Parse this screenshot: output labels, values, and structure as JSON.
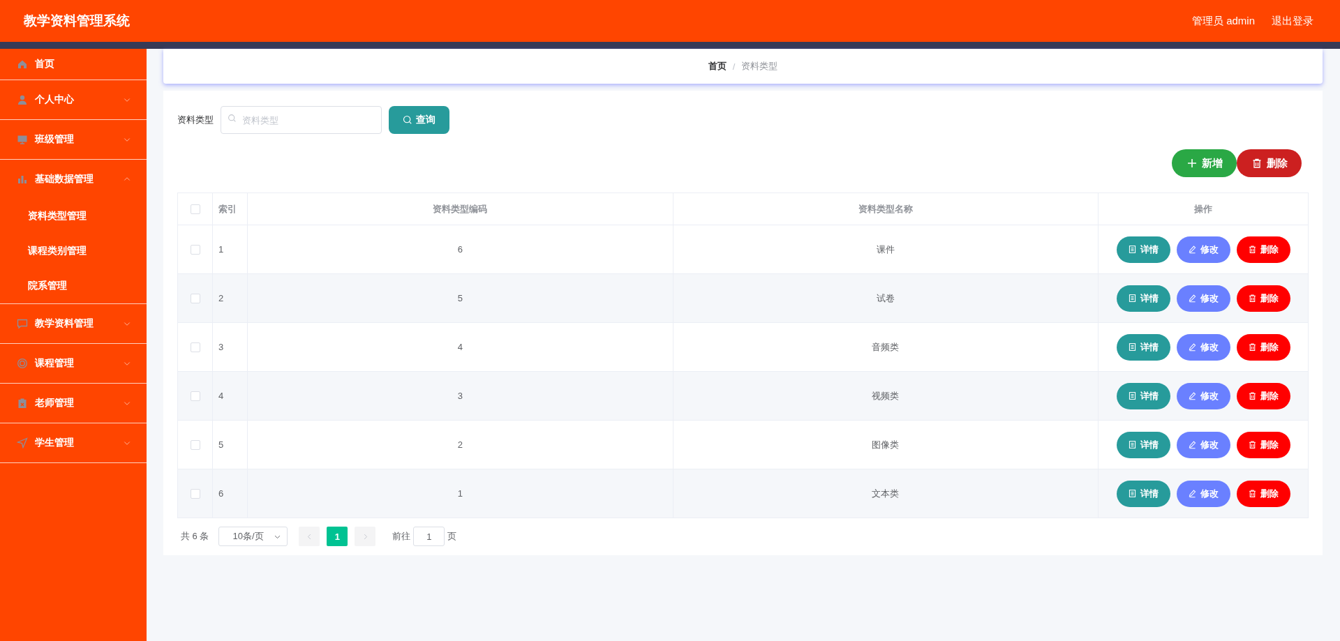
{
  "header": {
    "title": "教学资料管理系统",
    "user": "管理员 admin",
    "logout": "退出登录"
  },
  "sidebar": {
    "items": [
      {
        "label": "首页",
        "kind": "link"
      },
      {
        "label": "个人中心",
        "kind": "submenu",
        "expanded": false
      },
      {
        "label": "班级管理",
        "kind": "submenu",
        "expanded": false
      },
      {
        "label": "基础数据管理",
        "kind": "submenu",
        "expanded": true,
        "children": [
          {
            "label": "资料类型管理"
          },
          {
            "label": "课程类别管理"
          },
          {
            "label": "院系管理"
          }
        ]
      },
      {
        "label": "教学资料管理",
        "kind": "submenu",
        "expanded": false
      },
      {
        "label": "课程管理",
        "kind": "submenu",
        "expanded": false
      },
      {
        "label": "老师管理",
        "kind": "submenu",
        "expanded": false
      },
      {
        "label": "学生管理",
        "kind": "submenu",
        "expanded": false
      }
    ]
  },
  "breadcrumb": {
    "items": [
      {
        "label": "首页"
      },
      {
        "label": "资料类型"
      }
    ],
    "separator": "/"
  },
  "search": {
    "label": "资料类型",
    "placeholder": "资料类型",
    "button": "查询"
  },
  "toolbar": [
    {
      "label": "新增",
      "kind": "add"
    },
    {
      "label": "删除",
      "kind": "delete"
    }
  ],
  "table": {
    "all_checked": false,
    "columns": [
      "索引",
      "资料类型编码",
      "资料类型名称",
      "操作"
    ],
    "rows": [
      {
        "checked": false,
        "index": "1",
        "code": "6",
        "name": "课件",
        "actions": [
          {
            "label": "详情",
            "kind": "detail"
          },
          {
            "label": "修改",
            "kind": "edit"
          },
          {
            "label": "删除",
            "kind": "delete"
          }
        ]
      },
      {
        "checked": false,
        "index": "2",
        "code": "5",
        "name": "试卷",
        "actions": [
          {
            "label": "详情",
            "kind": "detail"
          },
          {
            "label": "修改",
            "kind": "edit"
          },
          {
            "label": "删除",
            "kind": "delete"
          }
        ]
      },
      {
        "checked": false,
        "index": "3",
        "code": "4",
        "name": "音频类",
        "actions": [
          {
            "label": "详情",
            "kind": "detail"
          },
          {
            "label": "修改",
            "kind": "edit"
          },
          {
            "label": "删除",
            "kind": "delete"
          }
        ]
      },
      {
        "checked": false,
        "index": "4",
        "code": "3",
        "name": "视频类",
        "actions": [
          {
            "label": "详情",
            "kind": "detail"
          },
          {
            "label": "修改",
            "kind": "edit"
          },
          {
            "label": "删除",
            "kind": "delete"
          }
        ]
      },
      {
        "checked": false,
        "index": "5",
        "code": "2",
        "name": "图像类",
        "actions": [
          {
            "label": "详情",
            "kind": "detail"
          },
          {
            "label": "修改",
            "kind": "edit"
          },
          {
            "label": "删除",
            "kind": "delete"
          }
        ]
      },
      {
        "checked": false,
        "index": "6",
        "code": "1",
        "name": "文本类",
        "actions": [
          {
            "label": "详情",
            "kind": "detail"
          },
          {
            "label": "修改",
            "kind": "edit"
          },
          {
            "label": "删除",
            "kind": "delete"
          }
        ]
      }
    ]
  },
  "pagination": {
    "total": "共 6 条",
    "page_size": "10条/页",
    "pages": [
      {
        "label": "1",
        "selected": true
      }
    ],
    "goto_label": "前往",
    "goto_value": "1",
    "page_suffix": "页"
  }
}
